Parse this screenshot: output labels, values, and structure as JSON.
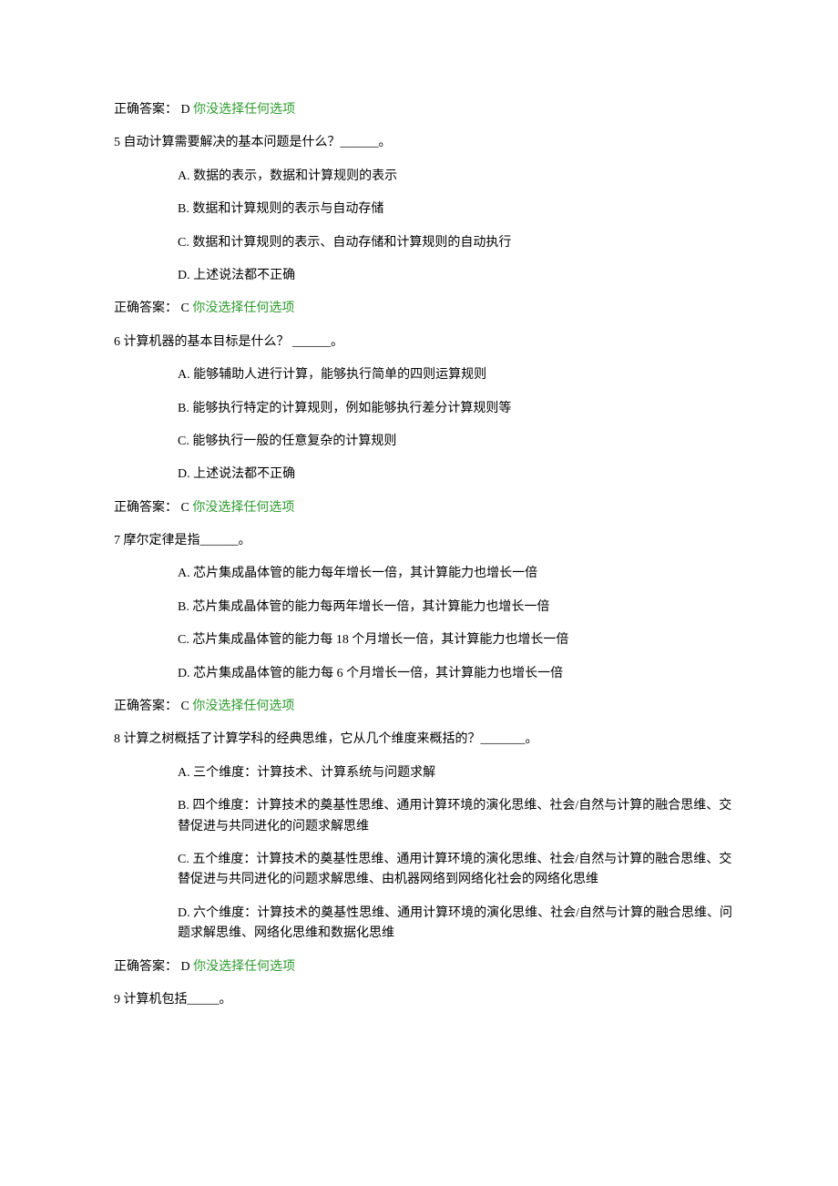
{
  "answer_label_prefix": "正确答案：",
  "no_select_text": "你没选择任何选项",
  "q4_answer_letter": " D ",
  "q5": {
    "stem": "5 自动计算需要解决的基本问题是什么？______。",
    "A": "A. 数据的表示，数据和计算规则的表示",
    "B": "B. 数据和计算规则的表示与自动存储",
    "C": "C. 数据和计算规则的表示、自动存储和计算规则的自动执行",
    "D": "D. 上述说法都不正确",
    "answer_letter": " C "
  },
  "q6": {
    "stem": "6 计算机器的基本目标是什么？ ______。",
    "A": "A. 能够辅助人进行计算，能够执行简单的四则运算规则",
    "B": "B. 能够执行特定的计算规则，例如能够执行差分计算规则等",
    "C": "C. 能够执行一般的任意复杂的计算规则",
    "D": "D. 上述说法都不正确",
    "answer_letter": " C "
  },
  "q7": {
    "stem": "7 摩尔定律是指______。",
    "A": "A. 芯片集成晶体管的能力每年增长一倍，其计算能力也增长一倍",
    "B": "B. 芯片集成晶体管的能力每两年增长一倍，其计算能力也增长一倍",
    "C": "C. 芯片集成晶体管的能力每 18 个月增长一倍，其计算能力也增长一倍",
    "D": "D. 芯片集成晶体管的能力每 6 个月增长一倍，其计算能力也增长一倍",
    "answer_letter": " C "
  },
  "q8": {
    "stem": "8 计算之树概括了计算学科的经典思维，它从几个维度来概括的？_______。",
    "A": "A. 三个维度：计算技术、计算系统与问题求解",
    "B": "B. 四个维度：计算技术的奠基性思维、通用计算环境的演化思维、社会/自然与计算的融合思维、交替促进与共同进化的问题求解思维",
    "C": "C. 五个维度：计算技术的奠基性思维、通用计算环境的演化思维、社会/自然与计算的融合思维、交替促进与共同进化的问题求解思维、由机器网络到网络化社会的网络化思维",
    "D": "D. 六个维度：计算技术的奠基性思维、通用计算环境的演化思维、社会/自然与计算的融合思维、问题求解思维、网络化思维和数据化思维",
    "answer_letter": " D "
  },
  "q9": {
    "stem": "9 计算机包括_____。"
  }
}
